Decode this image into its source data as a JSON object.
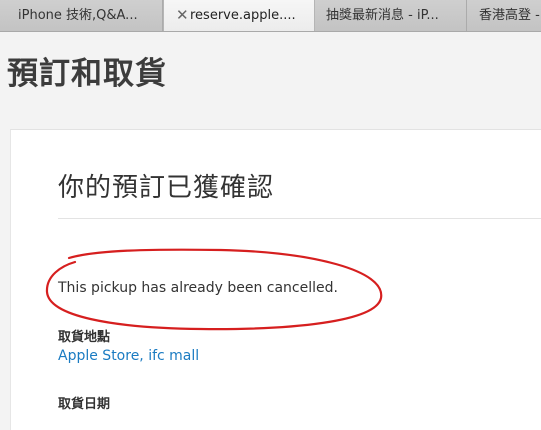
{
  "tabs": [
    {
      "label": "iPhone 技術,Q&A..."
    },
    {
      "label": "reserve.apple....",
      "close_glyph": "✕"
    },
    {
      "label": "抽獎最新消息 - iP..."
    },
    {
      "label": "香港高登 -"
    }
  ],
  "page": {
    "title": "預訂和取貨"
  },
  "confirmation": {
    "heading": "你的預訂已獲確認",
    "message": "This pickup has already been cancelled.",
    "pickup_location_label": "取貨地點",
    "pickup_location_value": "Apple Store, ifc mall",
    "pickup_date_label": "取貨日期"
  },
  "colors": {
    "annotation": "#d61f1f",
    "link": "#1a7bc2"
  }
}
